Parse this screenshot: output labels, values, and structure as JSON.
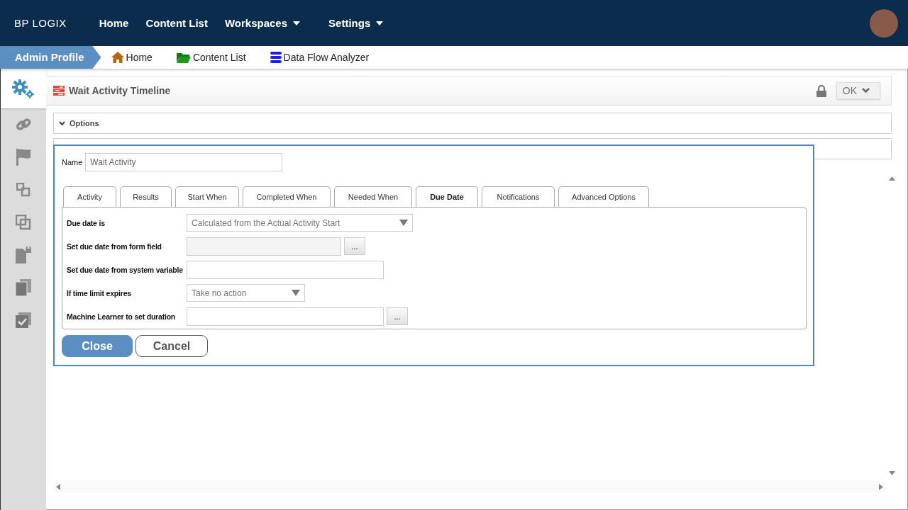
{
  "top_bar": {
    "logo": "BP LOGIX",
    "nav": [
      {
        "label": "Home",
        "kind": "link"
      },
      {
        "label": "Content List",
        "kind": "link"
      },
      {
        "label": "Workspaces",
        "kind": "menu"
      },
      {
        "label": "Settings",
        "kind": "menu"
      }
    ]
  },
  "breadcrumb": {
    "profile": "Admin Profile",
    "links": [
      {
        "label": "Home",
        "kind": "home"
      },
      {
        "label": "Content List",
        "kind": "folder"
      },
      {
        "label": "Data Flow Analyzer",
        "kind": "database"
      }
    ]
  },
  "sidebar": {
    "items": [
      {
        "kind": "gears",
        "selected": true
      },
      {
        "kind": "link",
        "selected": false
      },
      {
        "kind": "flag",
        "selected": false
      },
      {
        "kind": "boxes",
        "selected": false
      },
      {
        "kind": "copy",
        "selected": false
      },
      {
        "kind": "lockdoc",
        "selected": false
      },
      {
        "kind": "pages",
        "selected": false
      },
      {
        "kind": "check",
        "selected": false
      }
    ]
  },
  "panel": {
    "title": "Wait Activity Timeline",
    "locked": true,
    "ok_button": "OK",
    "sections": [
      {
        "title": "Options",
        "expanded": true
      }
    ]
  },
  "dialog": {
    "name_label": "Name",
    "name_value": "Wait Activity",
    "tabs": [
      {
        "label": "Activity",
        "selected": false
      },
      {
        "label": "Results",
        "selected": false
      },
      {
        "label": "Start When",
        "selected": false
      },
      {
        "label": "Completed When",
        "selected": false
      },
      {
        "label": "Needed When",
        "selected": false
      },
      {
        "label": "Due Date",
        "selected": true
      },
      {
        "label": "Notifications",
        "selected": false
      },
      {
        "label": "Advanced Options",
        "selected": false
      }
    ],
    "rows": [
      {
        "label": "Due date is",
        "kind": "select",
        "value": "Calculated from the Actual Activity Start",
        "wide": true
      },
      {
        "label": "Set due date from form field",
        "kind": "lookup",
        "disabled": true,
        "button": "..."
      },
      {
        "label": "Set due date from system variable",
        "kind": "text"
      },
      {
        "label": "If time limit expires",
        "kind": "select",
        "value": "Take no action",
        "wide": false
      },
      {
        "label": "Machine Learner to set duration",
        "kind": "lookup",
        "disabled": false,
        "button": "..."
      }
    ],
    "buttons": [
      {
        "label": "Close",
        "kind": "primary"
      },
      {
        "label": "Cancel",
        "kind": "secondary"
      }
    ]
  }
}
